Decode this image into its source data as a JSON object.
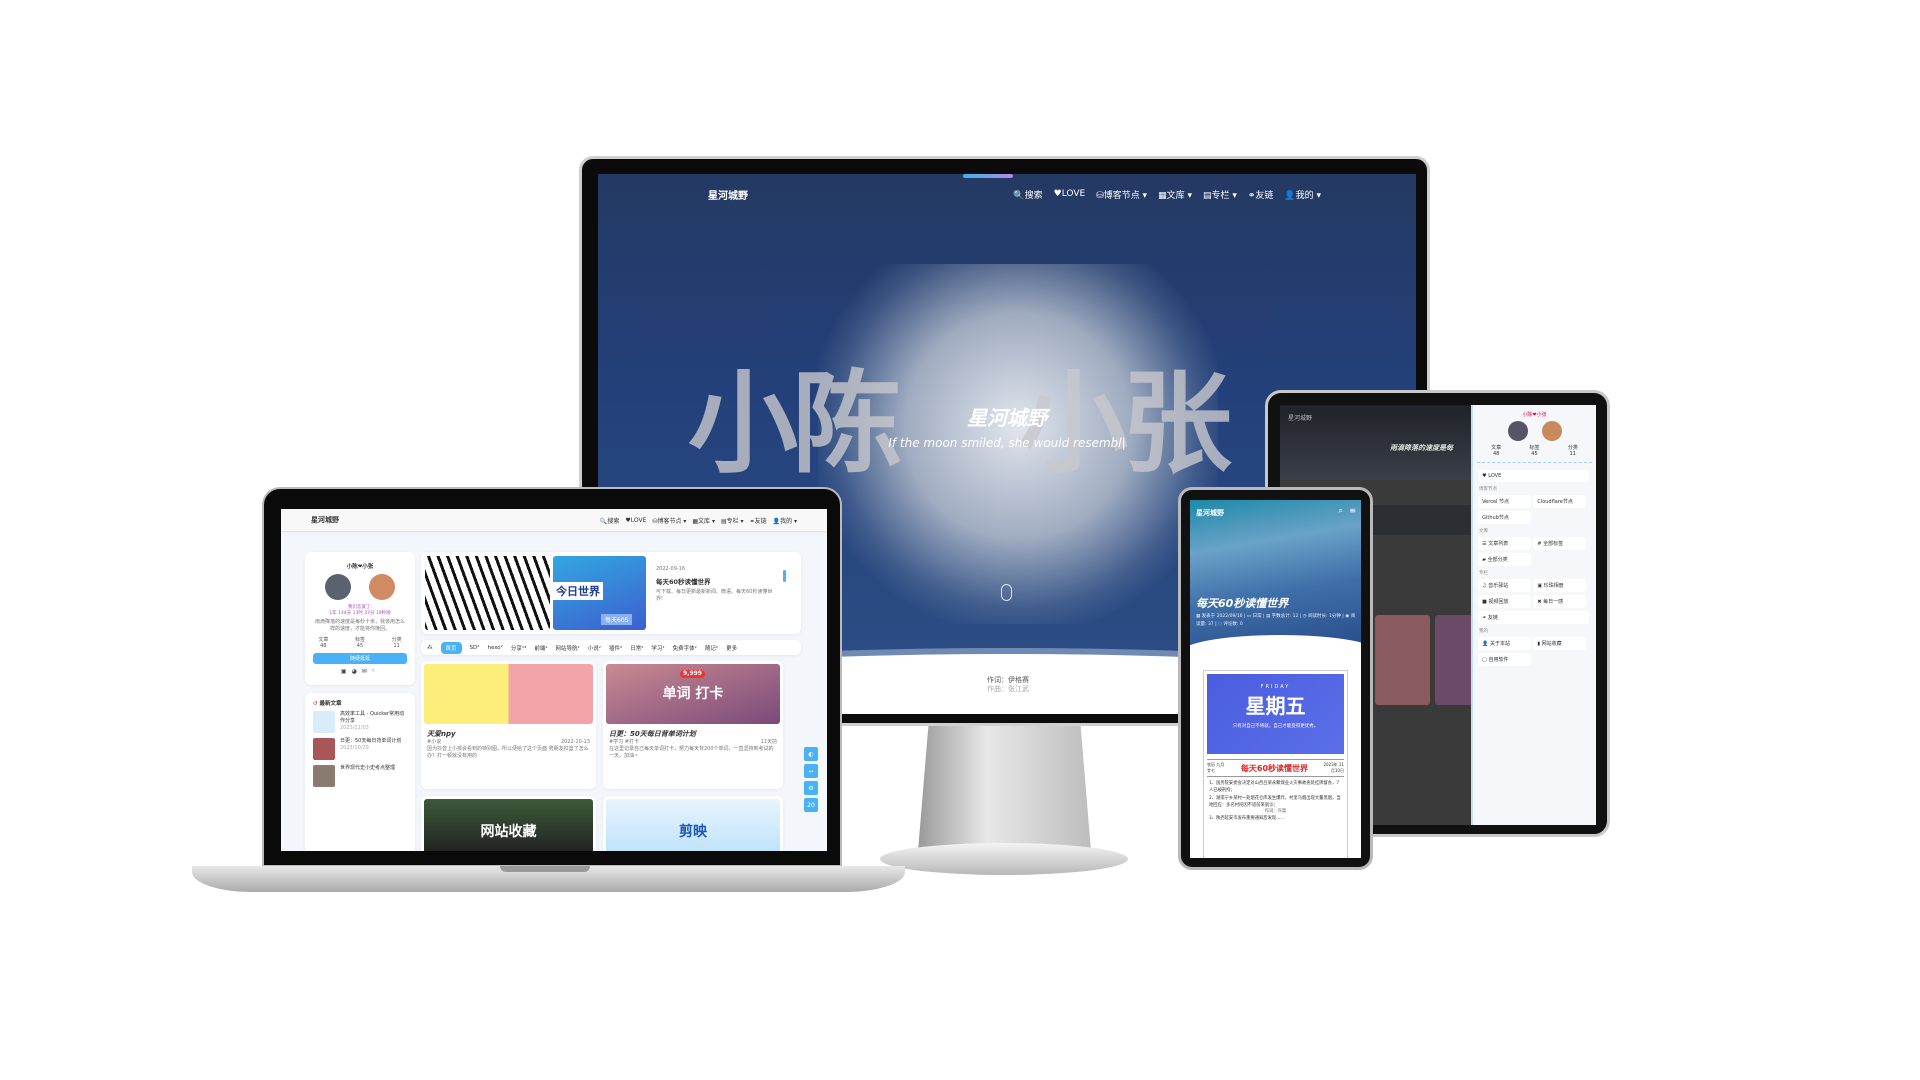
{
  "monitor": {
    "brand": "星河城野",
    "nav": [
      "🔍搜索",
      "♥LOVE",
      "⛁博客节点 ▾",
      "▦文库 ▾",
      "▤专栏 ▾",
      "⚭友链",
      "👤我的 ▾"
    ],
    "hero_title": "星河城野",
    "hero_subtitle": "If the moon smiled, she would resembl|",
    "bg_left": "小陈",
    "bg_right": "小张",
    "footer_line1": "作词：伊格赛",
    "footer_line2": "作曲：张江武"
  },
  "laptop": {
    "brand": "星河城野",
    "nav": [
      "🔍搜索",
      "♥LOVE",
      "⛁博客节点 ▾",
      "▦文库 ▾",
      "▤专栏 ▾",
      "⚭友链",
      "👤我的 ▾"
    ],
    "profile": {
      "couple": "小陈❤小张",
      "love_label": "我们恋爱了:",
      "love_time": "1年 144天 13时 37分 19秒啦",
      "quote": "雨滴降落的速度是每秒十米，我该用怎么样的速度，才能将你挽回。",
      "stats": [
        {
          "label": "文章",
          "value": "48"
        },
        {
          "label": "标签",
          "value": "45"
        },
        {
          "label": "分类",
          "value": "11"
        }
      ],
      "button": "随便逛逛"
    },
    "recent": {
      "title": "最新文章",
      "items": [
        {
          "title": "高效率工具 - Quicker常用动作分享",
          "date": "2023/11/03"
        },
        {
          "title": "日更：50天每日背单词计划",
          "date": "2023/10/29"
        },
        {
          "title": "世界现代史小史考点整理",
          "date": ""
        }
      ]
    },
    "banner": {
      "image_text": "今日世界",
      "image_badge": "每天60S",
      "date": "2022-09-16",
      "title": "每天60秒读懂世界",
      "desc": "可下载、每日更新最新新闻、微语、每天60秒读懂世界!"
    },
    "categories": [
      "首页",
      "SD²",
      "hexo²",
      "分享¹³",
      "前端²",
      "网站导航²",
      "小说²",
      "插件²",
      "日常²",
      "学习²",
      "免费字体²",
      "随记²",
      "更多"
    ],
    "posts": [
      {
        "title": "天爱npy",
        "tags": "#小说",
        "meta": "2022-10-13",
        "excerpt": "因为抖音上小孩会看到的特别图，所以便给了这个页面 男朋友扣篮了怎么办？打一顿就没有用的"
      },
      {
        "title": "日更：50天每日背单词计划",
        "tags": "#学习 #打卡",
        "meta": "11天前",
        "excerpt": "在这里记录自己每天单词打卡，努力每天背200个单词，一直坚持到考试的一天。加油~",
        "image_text": "单词  打卡",
        "badge": "9,999"
      }
    ],
    "more_posts": [
      "网站收藏",
      "剪映"
    ],
    "float_buttons": [
      "◐",
      "↔",
      "⚙",
      "20"
    ]
  },
  "tablet": {
    "brand": "星河城野",
    "quote": "雨滴降落的速度是每",
    "drawer": {
      "couple": "小陈❤小张",
      "stats": [
        {
          "label": "文章",
          "value": "48"
        },
        {
          "label": "标签",
          "value": "45"
        },
        {
          "label": "分类",
          "value": "11"
        }
      ],
      "love": "♥ LOVE",
      "sections": [
        {
          "title": "博客节点",
          "items": [
            "Vercel 节点",
            "Cloudflare节点",
            "Github节点"
          ]
        },
        {
          "title": "文库",
          "items": [
            "☰ 文章列表",
            "# 全部标签",
            "▰ 全部分类"
          ]
        },
        {
          "title": "专栏",
          "items": [
            "♫ 音乐驿站",
            "▣ 珍珠相册",
            "■ 视频回放",
            "✖ 每日一感",
            "⚭ 友链"
          ]
        },
        {
          "title": "我的",
          "items": [
            "👤 关于本站",
            "▮ 网站收藏",
            "▢ 自用软件"
          ]
        }
      ]
    }
  },
  "phone": {
    "brand": "星河城野",
    "post_title": "每天60秒读懂世界",
    "meta": "▦ 发表于 2022/09/16 | ▭ 日常 | ▤ 字数总计: 12 | ◷ 阅读时长: 1分钟 | ◉ 阅读量: 37 | ◌ 评论数: 0",
    "poster": {
      "day_en": "FRIDAY",
      "day_cn": "星期五",
      "motto": "只有对自己不将就，自己才能变得更优秀。",
      "lunar": "农历 九月廿七",
      "headline": "每天60秒读懂世界",
      "date": "2023年 11月10日",
      "news": [
        "1、国务院安委会决定对山西吕梁永聚煤业火灾事故查处挂牌督办，7人已被刑拘；",
        "2、湖南宁乡某村一处烟花仓库发生爆炸，村里乌烟出现大量黑烟，当地回应：多名村民因不适前来就诊；",
        "3、陕西延安市发布重要通知后发现……"
      ],
      "caption": "作词：许嵩"
    }
  }
}
